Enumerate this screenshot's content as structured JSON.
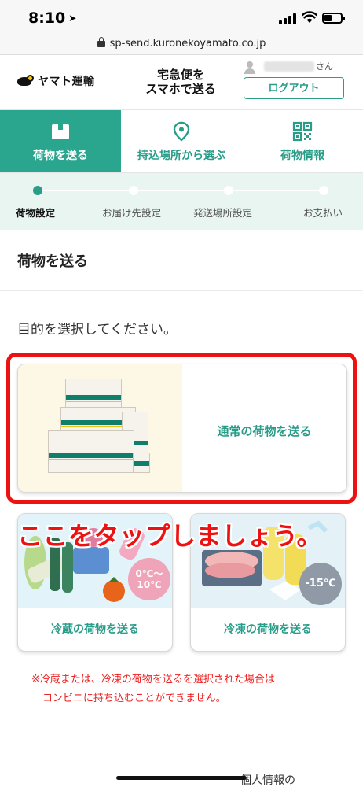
{
  "status_bar": {
    "time": "8:10",
    "location_glyph": "➤"
  },
  "url_bar": {
    "url": "sp-send.kuronekoyamato.co.jp"
  },
  "header": {
    "logo_text": "ヤマト運輸",
    "tagline_line1": "宅急便を",
    "tagline_line2": "スマホで送る",
    "user_suffix": "さん",
    "logout_label": "ログアウト"
  },
  "tabs": [
    {
      "label": "荷物を送る",
      "icon": "box-icon",
      "active": true
    },
    {
      "label": "持込場所から選ぶ",
      "icon": "map-pin-icon",
      "active": false
    },
    {
      "label": "荷物情報",
      "icon": "qr-code-icon",
      "active": false
    }
  ],
  "steps": [
    {
      "label": "荷物設定",
      "active": true
    },
    {
      "label": "お届け先設定",
      "active": false
    },
    {
      "label": "発送場所設定",
      "active": false
    },
    {
      "label": "お支払い",
      "active": false
    }
  ],
  "page_title": "荷物を送る",
  "instruction": "目的を選択してください。",
  "cards": {
    "normal": {
      "label": "通常の荷物を送る"
    },
    "chilled": {
      "label": "冷蔵の荷物を送る",
      "badge_line1": "0℃～",
      "badge_line2": "10℃"
    },
    "frozen": {
      "label": "冷凍の荷物を送る",
      "badge": "-15℃"
    }
  },
  "annotation": "ここをタップしましょう。",
  "notice_line1": "※冷蔵または、冷凍の荷物を送るを選択された場合は",
  "notice_line2": "コンビニに持ち込むことができません。",
  "footer": {
    "link_text": "個人情報の"
  },
  "colors": {
    "brand_green": "#2aa68f",
    "highlight_red": "#ee1111",
    "step_bg": "#e8f5f1"
  }
}
